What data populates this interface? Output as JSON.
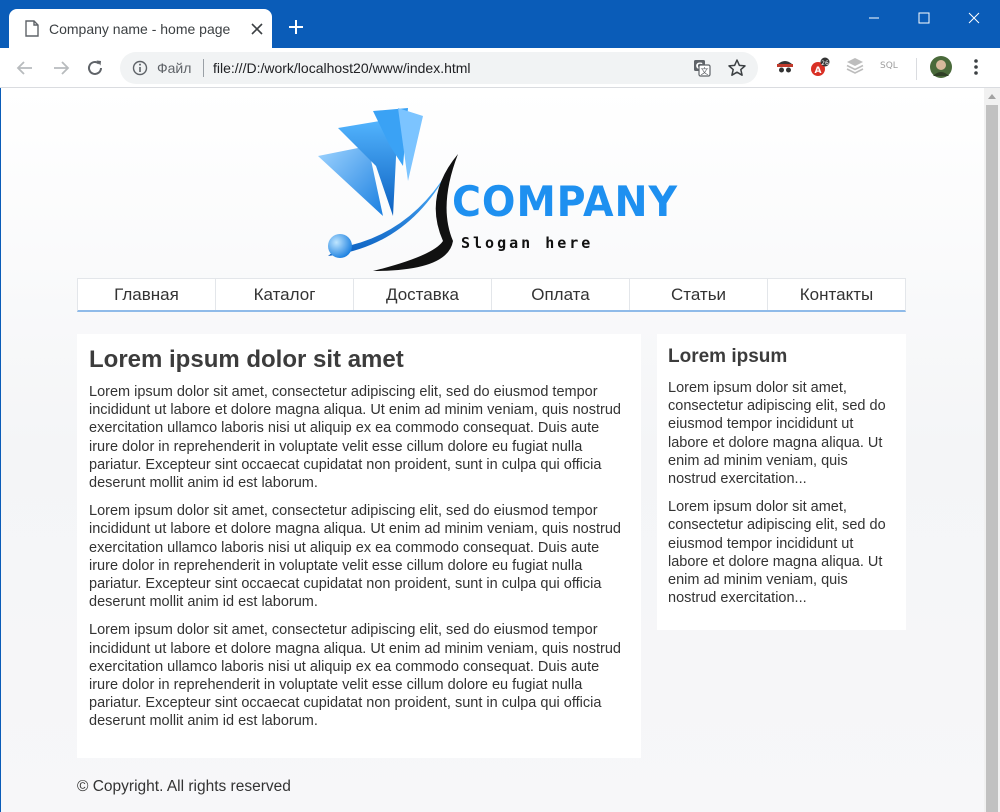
{
  "browser": {
    "tab_title": "Company name - home page",
    "scheme_label": "Файл",
    "url": "file:///D:/work/localhost20/www/index.html",
    "extensions": [
      "spy-icon",
      "adblock-icon",
      "layers-icon",
      "sql-icon",
      "profile-avatar"
    ],
    "sql_label": "SQL"
  },
  "logo": {
    "brand": "COMPANY",
    "slogan": "Slogan here",
    "brand_color": "#1e90f0"
  },
  "nav": {
    "items": [
      "Главная",
      "Каталог",
      "Доставка",
      "Оплата",
      "Статьи",
      "Контакты"
    ]
  },
  "main": {
    "title": "Lorem ipsum dolor sit amet",
    "paragraphs": [
      "Lorem ipsum dolor sit amet, consectetur adipiscing elit, sed do eiusmod tempor incididunt ut labore et dolore magna aliqua. Ut enim ad minim veniam, quis nostrud exercitation ullamco laboris nisi ut aliquip ex ea commodo consequat. Duis aute irure dolor in reprehenderit in voluptate velit esse cillum dolore eu fugiat nulla pariatur. Excepteur sint occaecat cupidatat non proident, sunt in culpa qui officia deserunt mollit anim id est laborum.",
      "Lorem ipsum dolor sit amet, consectetur adipiscing elit, sed do eiusmod tempor incididunt ut labore et dolore magna aliqua. Ut enim ad minim veniam, quis nostrud exercitation ullamco laboris nisi ut aliquip ex ea commodo consequat. Duis aute irure dolor in reprehenderit in voluptate velit esse cillum dolore eu fugiat nulla pariatur. Excepteur sint occaecat cupidatat non proident, sunt in culpa qui officia deserunt mollit anim id est laborum.",
      "Lorem ipsum dolor sit amet, consectetur adipiscing elit, sed do eiusmod tempor incididunt ut labore et dolore magna aliqua. Ut enim ad minim veniam, quis nostrud exercitation ullamco laboris nisi ut aliquip ex ea commodo consequat. Duis aute irure dolor in reprehenderit in voluptate velit esse cillum dolore eu fugiat nulla pariatur. Excepteur sint occaecat cupidatat non proident, sunt in culpa qui officia deserunt mollit anim id est laborum."
    ]
  },
  "sidebar": {
    "title": "Lorem ipsum",
    "paragraphs": [
      "Lorem ipsum dolor sit amet, consectetur adipiscing elit, sed do eiusmod tempor incididunt ut labore et dolore magna aliqua. Ut enim ad minim veniam, quis nostrud exercitation...",
      "Lorem ipsum dolor sit amet, consectetur adipiscing elit, sed do eiusmod tempor incididunt ut labore et dolore magna aliqua. Ut enim ad minim veniam, quis nostrud exercitation..."
    ]
  },
  "footer": {
    "copyright": "© Copyright. All rights reserved"
  },
  "colors": {
    "titlebar": "#0a5cb8",
    "nav_underline": "#8fbbe9",
    "text": "#333333"
  }
}
